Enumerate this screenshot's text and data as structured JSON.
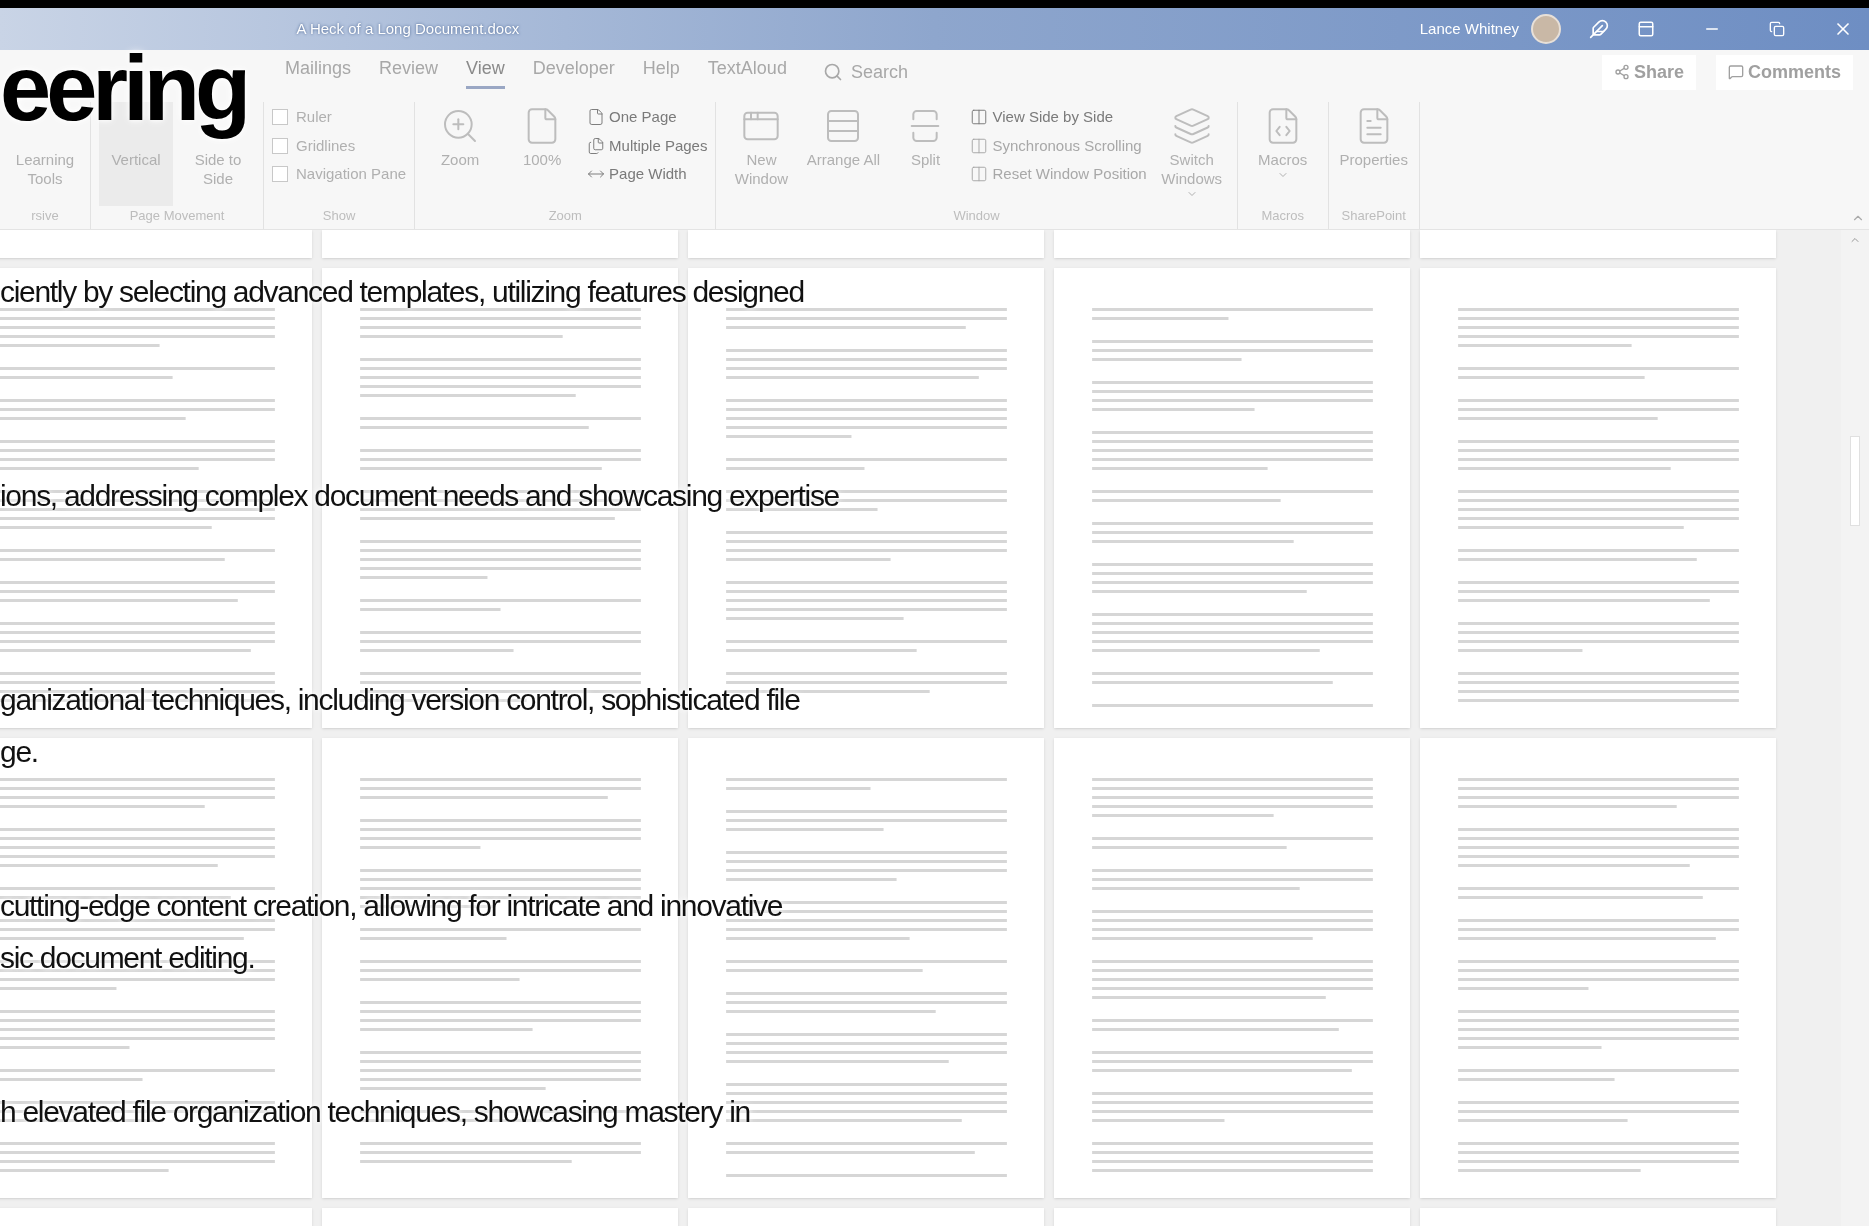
{
  "title_bar": {
    "title": "A Heck of a Long Document.docx",
    "user": "Lance Whitney"
  },
  "ribbon_tabs": [
    {
      "label": "Mailings",
      "selected": false
    },
    {
      "label": "Review",
      "selected": false
    },
    {
      "label": "View",
      "selected": true
    },
    {
      "label": "Developer",
      "selected": false
    },
    {
      "label": "Help",
      "selected": false
    },
    {
      "label": "TextAloud",
      "selected": false
    }
  ],
  "search": {
    "placeholder": "Search"
  },
  "share": "Share",
  "comments": "Comments",
  "ribbon_groups": [
    {
      "label": "rsive",
      "items": [
        {
          "kind": "large",
          "label": "Learning Tools"
        }
      ]
    },
    {
      "label": "Page Movement",
      "items": [
        {
          "kind": "large",
          "label": "Vertical",
          "selected": true
        },
        {
          "kind": "large",
          "label": "Side to Side",
          "selected": false
        }
      ]
    },
    {
      "label": "Show",
      "items": [
        {
          "kind": "check",
          "label": "Ruler",
          "checked": false
        },
        {
          "kind": "check",
          "label": "Gridlines",
          "checked": false
        },
        {
          "kind": "check",
          "label": "Navigation Pane",
          "checked": false
        }
      ]
    },
    {
      "label": "Zoom",
      "items": [
        {
          "kind": "large",
          "label": "Zoom"
        },
        {
          "kind": "large",
          "label": "100%"
        },
        {
          "kind": "small",
          "label": "One Page"
        },
        {
          "kind": "small",
          "label": "Multiple Pages"
        },
        {
          "kind": "small",
          "label": "Page Width"
        }
      ]
    },
    {
      "label": "Window",
      "items": [
        {
          "kind": "large",
          "label": "New Window"
        },
        {
          "kind": "large",
          "label": "Arrange All"
        },
        {
          "kind": "large",
          "label": "Split"
        },
        {
          "kind": "small",
          "label": "View Side by Side",
          "disabled": false
        },
        {
          "kind": "small",
          "label": "Synchronous Scrolling",
          "disabled": true
        },
        {
          "kind": "small",
          "label": "Reset Window Position",
          "disabled": true
        },
        {
          "kind": "large",
          "label": "Switch Windows",
          "dropdown": true
        }
      ]
    },
    {
      "label": "Macros",
      "items": [
        {
          "kind": "large",
          "label": "Macros",
          "dropdown": true
        }
      ]
    },
    {
      "label": "SharePoint",
      "items": [
        {
          "kind": "large",
          "label": "Properties"
        }
      ]
    }
  ],
  "overlay": {
    "heading": "eering",
    "lines": [
      "ciently by selecting advanced templates, utilizing features designed",
      "ions, addressing complex document needs and showcasing expertise",
      "ganizational techniques, including version control, sophisticated file",
      "ge.",
      "cutting-edge content creation, allowing for intricate and innovative",
      "sic document editing.",
      "h elevated file organization techniques, showcasing mastery in"
    ]
  }
}
